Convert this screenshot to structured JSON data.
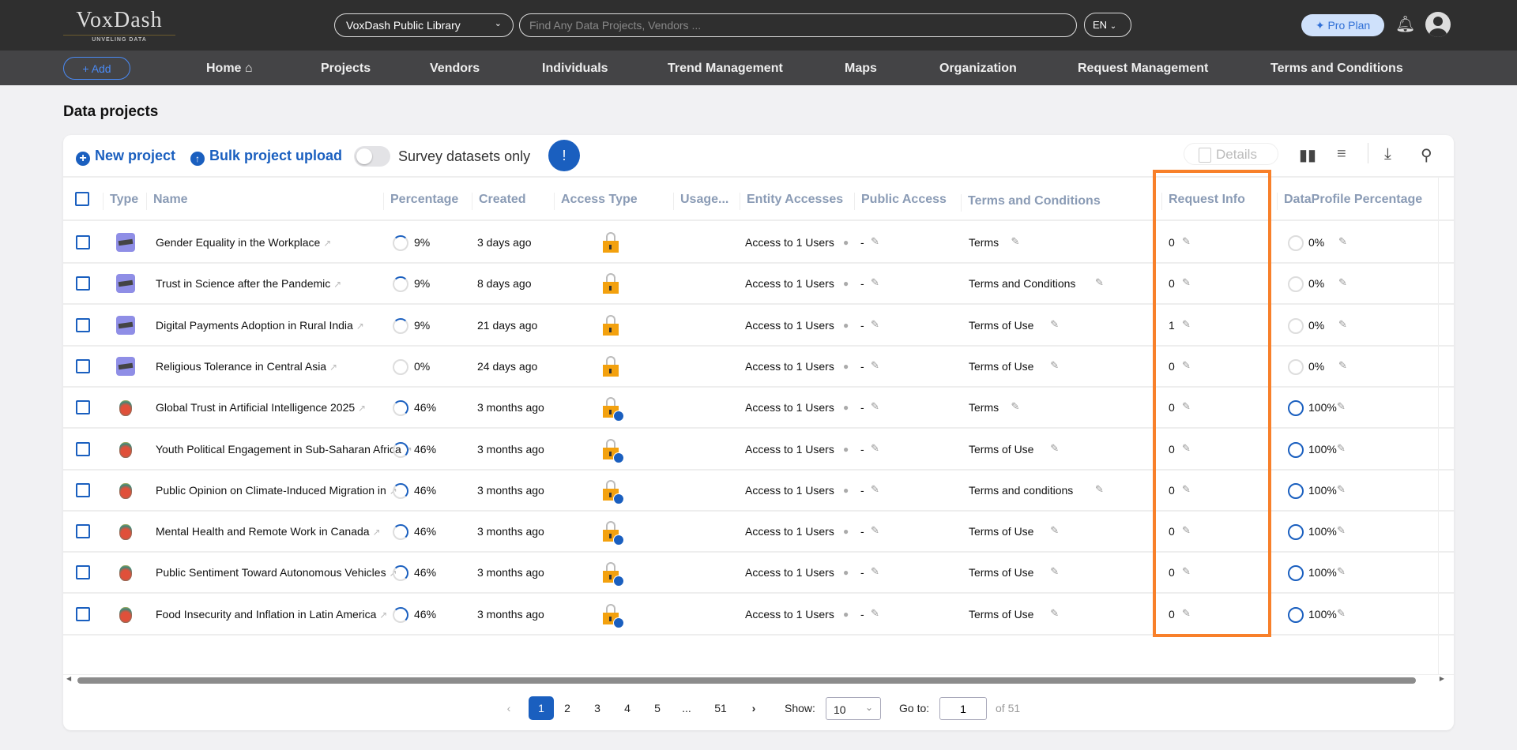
{
  "header": {
    "logo": "VoxDash",
    "logo_tagline": "UNVELING DATA",
    "library": "VoxDash Public Library",
    "search_placeholder": "Find Any Data Projects, Vendors ...",
    "language": "EN",
    "pro_plan": "Pro Plan"
  },
  "nav": {
    "add": "Add",
    "items": [
      "Home",
      "Projects",
      "Vendors",
      "Individuals",
      "Trend Management",
      "Maps",
      "Organization",
      "Request Management",
      "Terms and Conditions"
    ]
  },
  "page_title": "Data projects",
  "toolbar": {
    "new_project": "New project",
    "bulk_upload": "Bulk project upload",
    "survey_toggle": "Survey datasets only",
    "survey_toggle_on": false,
    "details": "Details"
  },
  "columns": [
    "Type",
    "Name",
    "Percentage",
    "Created",
    "Access Type",
    "Usage...",
    "Entity Accesses",
    "Public Access",
    "Terms and Conditions",
    "Request Info",
    "DataProfile Percentage"
  ],
  "rows": [
    {
      "type": "survey",
      "name": "Gender Equality in the Workplace",
      "percentage": "9%",
      "created": "3 days ago",
      "access": "locked",
      "entity": "Access to 1 Users",
      "public": "-",
      "terms": "Terms",
      "request": "0",
      "dataprofile": "0%"
    },
    {
      "type": "survey",
      "name": "Trust in Science after the Pandemic",
      "percentage": "9%",
      "created": "8 days ago",
      "access": "locked",
      "entity": "Access to 1 Users",
      "public": "-",
      "terms": "Terms and Conditions",
      "request": "0",
      "dataprofile": "0%"
    },
    {
      "type": "survey",
      "name": "Digital Payments Adoption in Rural India",
      "percentage": "9%",
      "created": "21 days ago",
      "access": "locked",
      "entity": "Access to 1 Users",
      "public": "-",
      "terms": "Terms of Use",
      "request": "1",
      "dataprofile": "0%"
    },
    {
      "type": "survey",
      "name": "Religious Tolerance in Central Asia",
      "percentage": "0%",
      "created": "24 days ago",
      "access": "locked",
      "entity": "Access to 1 Users",
      "public": "-",
      "terms": "Terms of Use",
      "request": "0",
      "dataprofile": "0%"
    },
    {
      "type": "study",
      "name": "Global Trust in Artificial Intelligence 2025",
      "percentage": "46%",
      "created": "3 months ago",
      "access": "locked-user",
      "entity": "Access to 1 Users",
      "public": "-",
      "terms": "Terms",
      "request": "0",
      "dataprofile": "100%"
    },
    {
      "type": "study",
      "name": "Youth Political Engagement in Sub-Saharan Africa",
      "percentage": "46%",
      "created": "3 months ago",
      "access": "locked-user",
      "entity": "Access to 1 Users",
      "public": "-",
      "terms": "Terms of Use",
      "request": "0",
      "dataprofile": "100%"
    },
    {
      "type": "study",
      "name": "Public Opinion on Climate-Induced Migration in",
      "percentage": "46%",
      "created": "3 months ago",
      "access": "locked-user",
      "entity": "Access to 1 Users",
      "public": "-",
      "terms": "Terms and conditions",
      "request": "0",
      "dataprofile": "100%"
    },
    {
      "type": "study",
      "name": "Mental Health and Remote Work in Canada",
      "percentage": "46%",
      "created": "3 months ago",
      "access": "locked-user",
      "entity": "Access to 1 Users",
      "public": "-",
      "terms": "Terms of Use",
      "request": "0",
      "dataprofile": "100%"
    },
    {
      "type": "study",
      "name": "Public Sentiment Toward Autonomous Vehicles",
      "percentage": "46%",
      "created": "3 months ago",
      "access": "locked-user",
      "entity": "Access to 1 Users",
      "public": "-",
      "terms": "Terms of Use",
      "request": "0",
      "dataprofile": "100%"
    },
    {
      "type": "study",
      "name": "Food Insecurity and Inflation in Latin America",
      "percentage": "46%",
      "created": "3 months ago",
      "access": "locked-user",
      "entity": "Access to 1 Users",
      "public": "-",
      "terms": "Terms of Use",
      "request": "0",
      "dataprofile": "100%"
    }
  ],
  "pagination": {
    "pages": [
      "1",
      "2",
      "3",
      "4",
      "5",
      "...",
      "51"
    ],
    "current": "1",
    "show_label": "Show:",
    "page_size": "10",
    "goto_label": "Go to:",
    "goto_value": "1",
    "of_total": "of 51"
  },
  "colors": {
    "accent": "#1a5fbf",
    "highlight": "#f8802a",
    "lock": "#f3a10e"
  }
}
